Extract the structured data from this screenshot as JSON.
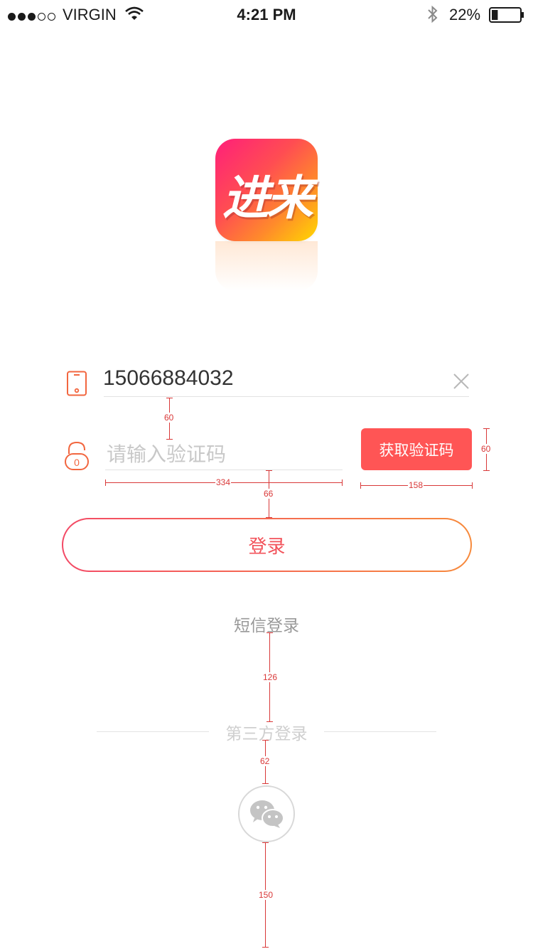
{
  "status_bar": {
    "carrier": "VIRGIN",
    "time": "4:21 PM",
    "battery": "22%",
    "signal_bars": 3,
    "battery_level": 0.22,
    "icons": [
      "signal-dots-icon",
      "wifi-icon",
      "bluetooth-icon",
      "battery-icon"
    ]
  },
  "logo": {
    "text": "进来",
    "gradient": [
      "#ff1f7a",
      "#ff4d52",
      "#ff8a2b",
      "#ffd800"
    ]
  },
  "login_form": {
    "phone": {
      "value": "15066884032",
      "icon": "phone-icon",
      "clear_icon": "close-icon"
    },
    "code": {
      "placeholder": "请输入验证码",
      "icon": "lock-icon"
    },
    "get_code_button": "获取验证码",
    "login_button": "登录"
  },
  "sms_login_label": "短信登录",
  "third_party": {
    "label": "第三方登录",
    "providers": [
      "wechat-icon"
    ]
  },
  "annotations": {
    "gap_phone_code": "60",
    "code_input_width": "334",
    "code_button_height": "60",
    "code_button_width": "158",
    "gap_code_login": "66",
    "gap_sms_third": "126",
    "gap_third_wechat": "62",
    "gap_wechat_bottom": "150"
  },
  "colors": {
    "accent_red": "#ff5555",
    "login_gradient_start": "#f34a66",
    "login_gradient_end": "#f78a3c",
    "annotation_red": "#d93838"
  }
}
